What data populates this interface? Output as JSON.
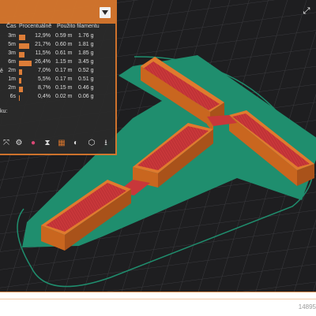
{
  "legend": {
    "headers": {
      "time": "Čas",
      "percent": "Procentuálně",
      "filament": "Použito filamentu"
    },
    "rows": [
      {
        "time": "3m",
        "percent": "12,9%",
        "meters": "0.59 m",
        "grams": "1.76 g",
        "fraction": 0.129
      },
      {
        "time": "5m",
        "percent": "21,7%",
        "meters": "0.60 m",
        "grams": "1.81 g",
        "fraction": 0.217
      },
      {
        "time": "3m",
        "percent": "11,5%",
        "meters": "0.61 m",
        "grams": "1.85 g",
        "fraction": 0.115
      },
      {
        "time": "6m",
        "percent": "26,4%",
        "meters": "1.15 m",
        "grams": "3.45 g",
        "fraction": 0.264
      },
      {
        "time": "2m",
        "percent": "7,0%",
        "meters": "0.17 m",
        "grams": "0.52 g",
        "fraction": 0.07
      },
      {
        "time": "1m",
        "percent": "5,5%",
        "meters": "0.17 m",
        "grams": "0.51 g",
        "fraction": 0.055
      },
      {
        "time": "2m",
        "percent": "8,7%",
        "meters": "0.15 m",
        "grams": "0.46 g",
        "fraction": 0.087
      },
      {
        "time": "6s",
        "percent": "0,4%",
        "meters": "0.02 m",
        "grams": "0.06 g",
        "fraction": 0.004
      }
    ],
    "row_prefix_partial": "ě",
    "footer_partial": "ku:"
  },
  "toolbar": {
    "icons": [
      "move-icon",
      "settings-icon",
      "color-icon",
      "hourglass-icon",
      "compare-icon",
      "checker-icon",
      "cube-icon",
      "download-icon"
    ]
  },
  "status": {
    "number_partial": "14895"
  },
  "colors": {
    "accent": "#d9782d",
    "brim": "#1f8e6e",
    "wall": "#e07a2e",
    "infill": "#c8373a",
    "bed": "#1e1e20"
  }
}
